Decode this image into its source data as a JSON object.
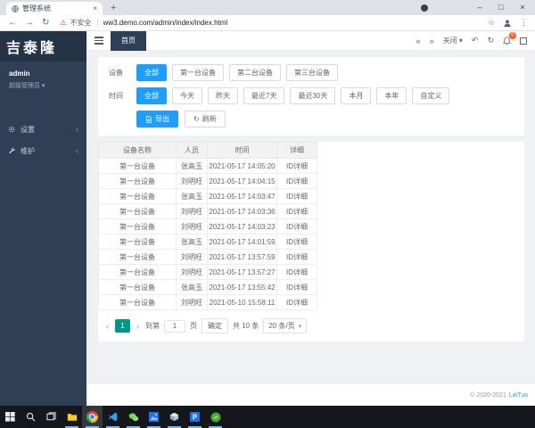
{
  "browser": {
    "tab": {
      "title": "管理系统",
      "close": "×",
      "new_tab": "+"
    },
    "window_controls": {
      "minimize": "–",
      "maximize": "□",
      "close": "×"
    },
    "address": {
      "security": "不安全",
      "url": "ww3.demo.com/admin/index/index.html"
    }
  },
  "sidebar": {
    "logo": "吉泰隆",
    "username": "admin",
    "role": "超级管理员",
    "items": [
      {
        "label": "设置"
      },
      {
        "label": "维护"
      }
    ]
  },
  "header": {
    "tab": "首页",
    "close_menu": "关闭",
    "bell_badge": "0"
  },
  "filters": {
    "device": {
      "label": "设备",
      "options": [
        "全部",
        "第一台设备",
        "第二台设备",
        "第三台设备"
      ],
      "active": 0
    },
    "time": {
      "label": "时间",
      "options": [
        "全部",
        "今天",
        "昨天",
        "最近7天",
        "最近30天",
        "本月",
        "本年",
        "自定义"
      ],
      "active": 0
    },
    "export_label": "导出",
    "refresh_label": "刷新"
  },
  "table": {
    "columns": [
      "设备名称",
      "人员",
      "时间",
      "详细"
    ],
    "rows": [
      [
        "第一台设备",
        "张高玉",
        "2021-05-17 14:05:20",
        "ID详细"
      ],
      [
        "第一台设备",
        "刘明旺",
        "2021-05-17 14:04:15",
        "ID详细"
      ],
      [
        "第一台设备",
        "张高玉",
        "2021-05-17 14:03:47",
        "ID详细"
      ],
      [
        "第一台设备",
        "刘明旺",
        "2021-05-17 14:03:36",
        "ID详细"
      ],
      [
        "第一台设备",
        "刘明旺",
        "2021-05-17 14:03:23",
        "ID详细"
      ],
      [
        "第一台设备",
        "张高玉",
        "2021-05-17 14:01:59",
        "ID详细"
      ],
      [
        "第一台设备",
        "刘明旺",
        "2021-05-17 13:57:59",
        "ID详细"
      ],
      [
        "第一台设备",
        "刘明旺",
        "2021-05-17 13:57:27",
        "ID详细"
      ],
      [
        "第一台设备",
        "张高玉",
        "2021-05-17 13:55:42",
        "ID详细"
      ],
      [
        "第一台设备",
        "刘明旺",
        "2021-05-10 15:58:11",
        "ID详细"
      ]
    ]
  },
  "pagination": {
    "page": "1",
    "jump_prefix": "到第",
    "jump_value": "1",
    "jump_suffix": "页",
    "confirm": "确定",
    "total": "共 10 条",
    "page_size": "20 条/页"
  },
  "footer": {
    "copyright": "© 2020-2021",
    "brand": "LaiTuo"
  },
  "taskbar_icons": [
    "start",
    "search",
    "task-view",
    "file-explorer",
    "chrome",
    "vscode",
    "wechat",
    "photos",
    "3d-viewer",
    "p-app",
    "green-app"
  ],
  "colors": {
    "accent_blue": "#1E9FFF",
    "accent_green": "#009688",
    "sidebar_navy": "#2f4056",
    "badge_red": "#ff5722"
  }
}
